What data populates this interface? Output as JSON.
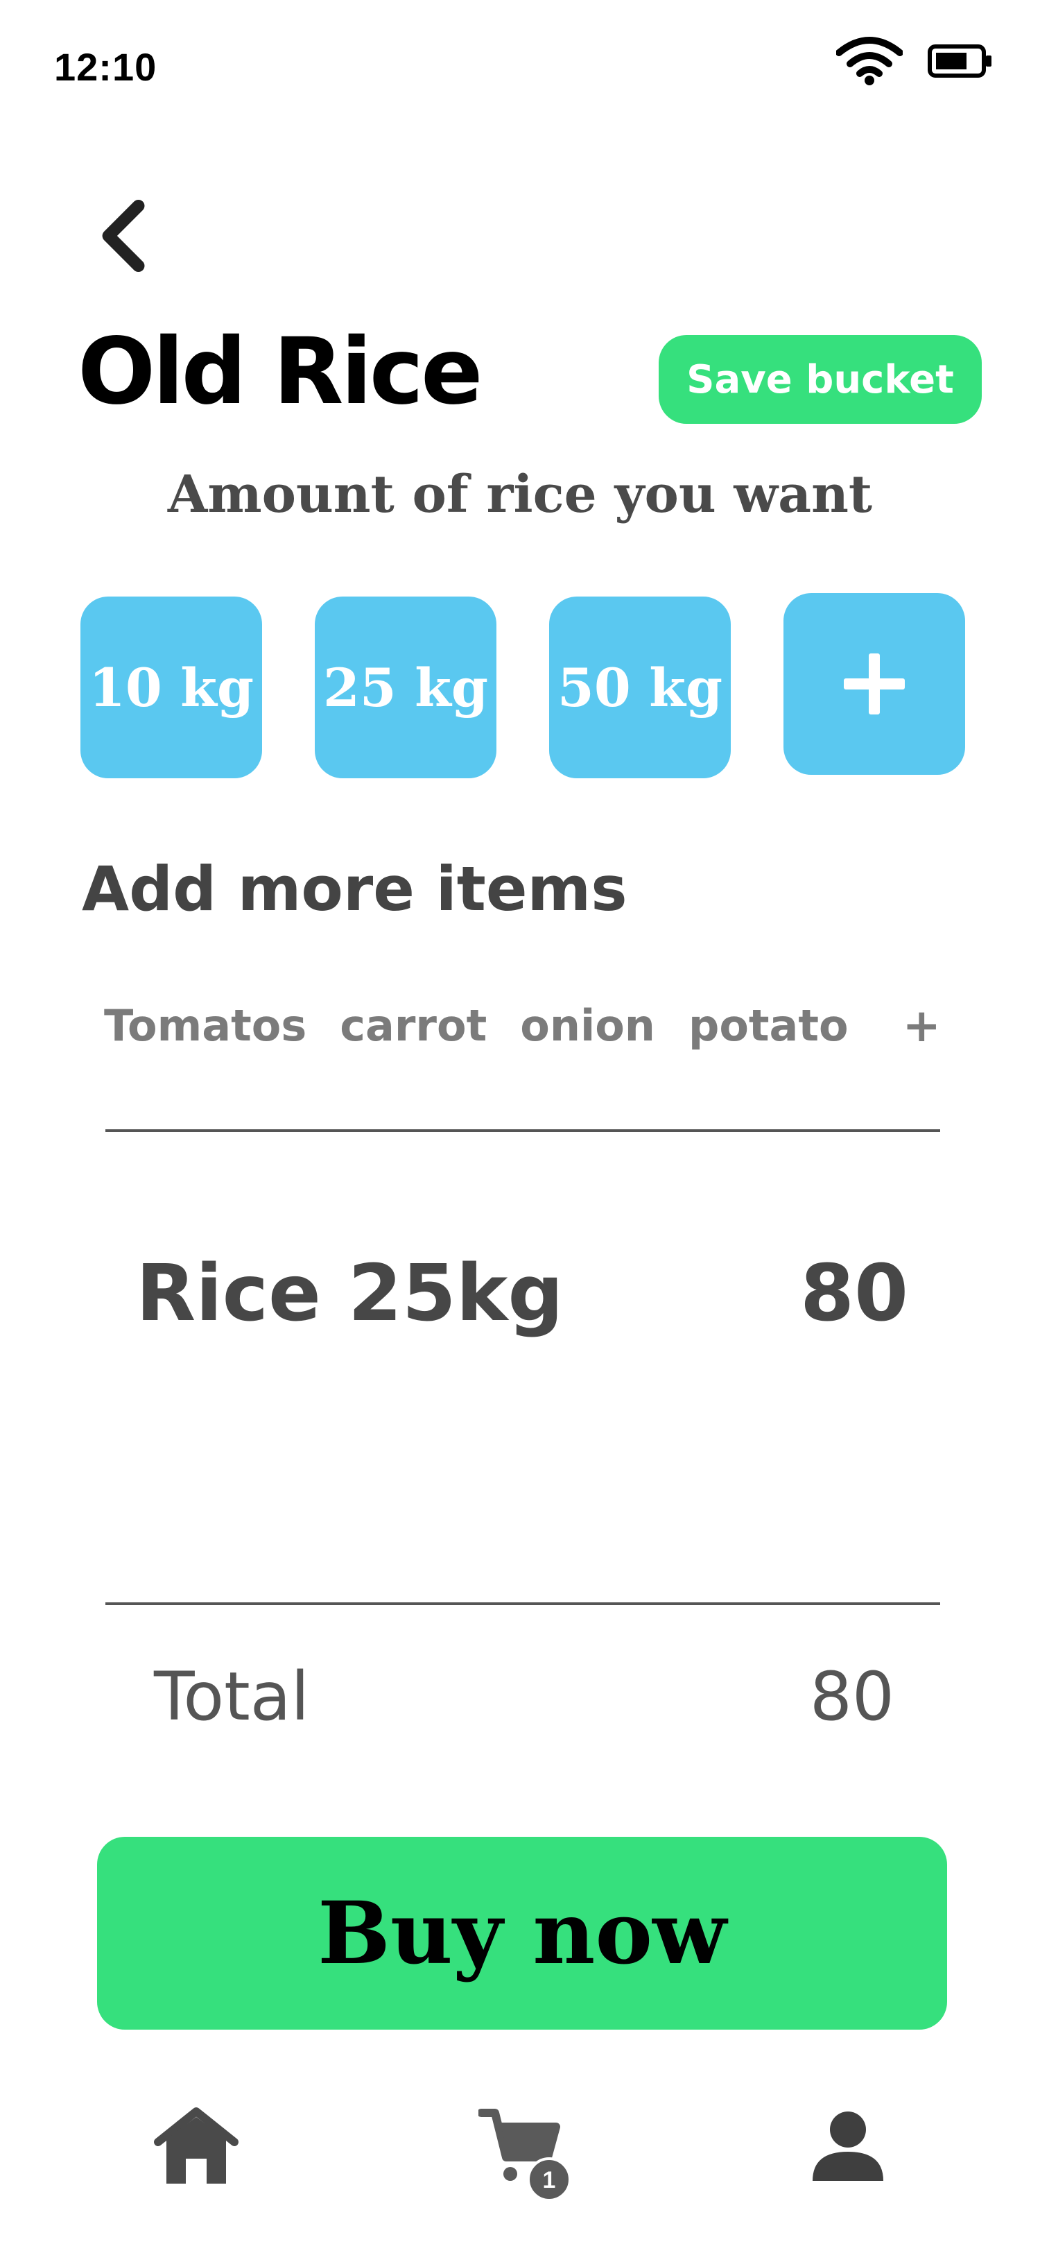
{
  "status_bar": {
    "time": "12:10",
    "wifi_icon": "wifi-icon",
    "battery_icon": "battery-icon"
  },
  "header": {
    "back_icon": "chevron-left-icon",
    "title": "Old Rice",
    "save_label": "Save bucket"
  },
  "amount": {
    "subtitle": "Amount of rice you want",
    "options": [
      "10 kg",
      "25 kg",
      "50 kg"
    ],
    "add_icon": "plus-icon"
  },
  "add_items": {
    "title": "Add more items",
    "items": [
      "Tomatos",
      "carrot",
      "onion",
      "potato"
    ],
    "add_label": "+"
  },
  "cart_line": {
    "name": "Rice 25kg",
    "price": "80"
  },
  "total": {
    "label": "Total",
    "value": "80"
  },
  "buy_label": "Buy now",
  "bottom_nav": {
    "home_icon": "home-icon",
    "cart_icon": "cart-icon",
    "cart_badge": "1",
    "profile_icon": "user-icon"
  },
  "colors": {
    "green": "#36e07d",
    "blue": "#5ac8f0",
    "dark_text": "#474747"
  }
}
